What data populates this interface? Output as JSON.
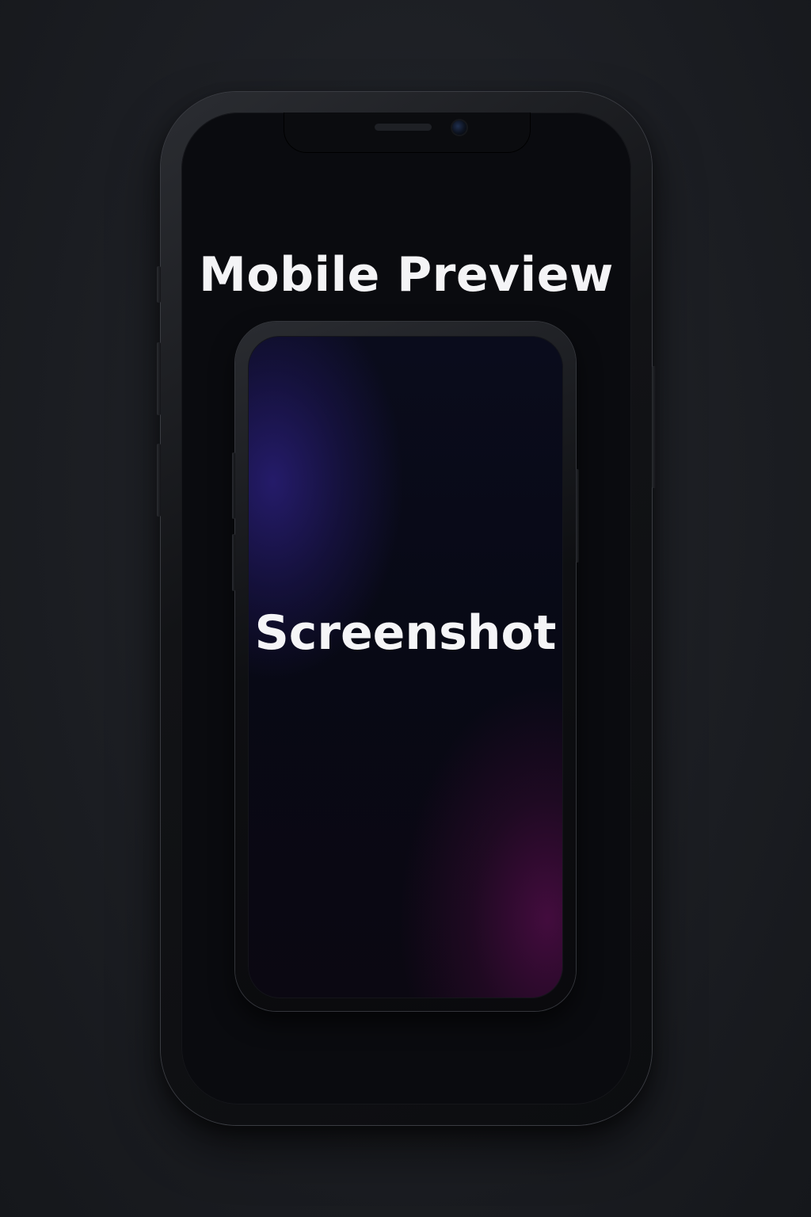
{
  "preview": {
    "title": "Mobile Preview",
    "screen_label": "Screenshot"
  },
  "colors": {
    "background": "#1c1e23",
    "phone_body": "#0c0d10",
    "screen_gradient_blue": "#261c6e",
    "screen_gradient_magenta": "#460c40",
    "text": "#f4f4f6"
  }
}
